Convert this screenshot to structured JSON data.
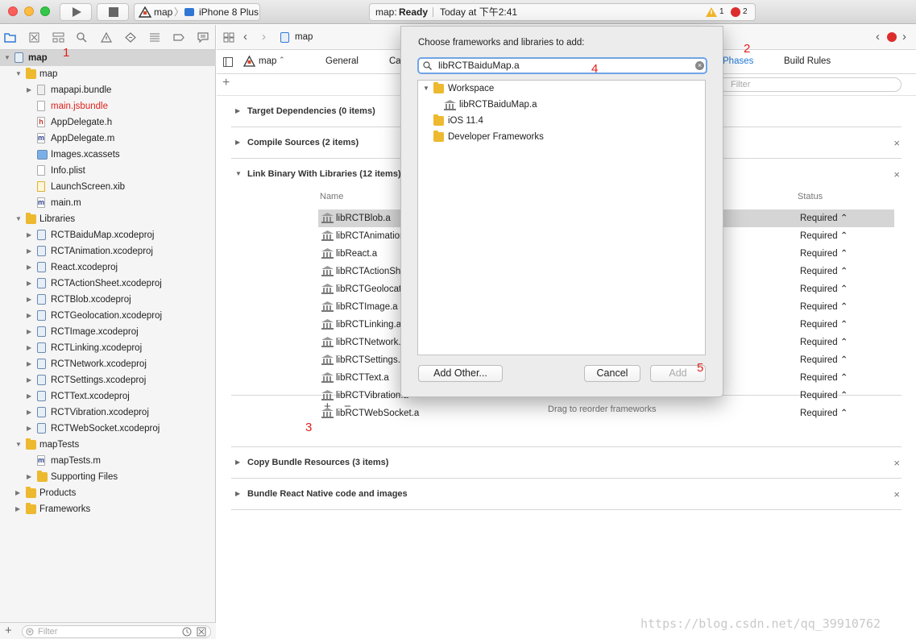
{
  "toolbar": {
    "scheme_target": "map",
    "scheme_device": "iPhone 8 Plus",
    "status_app": "map:",
    "status_state": "Ready",
    "status_time": "Today at 下午2:41",
    "warning_count": "1",
    "error_count": "2"
  },
  "navigator": {
    "items": [
      {
        "label": "map",
        "depth": 0,
        "icon": "project",
        "open": true
      },
      {
        "label": "map",
        "depth": 1,
        "icon": "folder",
        "open": true
      },
      {
        "label": "mapapi.bundle",
        "depth": 2,
        "icon": "bundle",
        "closed": true
      },
      {
        "label": "main.jsbundle",
        "depth": 2,
        "icon": "file",
        "red": true
      },
      {
        "label": "AppDelegate.h",
        "depth": 2,
        "icon": "h"
      },
      {
        "label": "AppDelegate.m",
        "depth": 2,
        "icon": "m"
      },
      {
        "label": "Images.xcassets",
        "depth": 2,
        "icon": "assets"
      },
      {
        "label": "Info.plist",
        "depth": 2,
        "icon": "file"
      },
      {
        "label": "LaunchScreen.xib",
        "depth": 2,
        "icon": "xib"
      },
      {
        "label": "main.m",
        "depth": 2,
        "icon": "m"
      },
      {
        "label": "Libraries",
        "depth": 1,
        "icon": "folder",
        "open": true
      },
      {
        "label": "RCTBaiduMap.xcodeproj",
        "depth": 2,
        "icon": "project",
        "closed": true
      },
      {
        "label": "RCTAnimation.xcodeproj",
        "depth": 2,
        "icon": "project",
        "closed": true
      },
      {
        "label": "React.xcodeproj",
        "depth": 2,
        "icon": "project",
        "closed": true
      },
      {
        "label": "RCTActionSheet.xcodeproj",
        "depth": 2,
        "icon": "project",
        "closed": true
      },
      {
        "label": "RCTBlob.xcodeproj",
        "depth": 2,
        "icon": "project",
        "closed": true
      },
      {
        "label": "RCTGeolocation.xcodeproj",
        "depth": 2,
        "icon": "project",
        "closed": true
      },
      {
        "label": "RCTImage.xcodeproj",
        "depth": 2,
        "icon": "project",
        "closed": true
      },
      {
        "label": "RCTLinking.xcodeproj",
        "depth": 2,
        "icon": "project",
        "closed": true
      },
      {
        "label": "RCTNetwork.xcodeproj",
        "depth": 2,
        "icon": "project",
        "closed": true
      },
      {
        "label": "RCTSettings.xcodeproj",
        "depth": 2,
        "icon": "project",
        "closed": true
      },
      {
        "label": "RCTText.xcodeproj",
        "depth": 2,
        "icon": "project",
        "closed": true
      },
      {
        "label": "RCTVibration.xcodeproj",
        "depth": 2,
        "icon": "project",
        "closed": true
      },
      {
        "label": "RCTWebSocket.xcodeproj",
        "depth": 2,
        "icon": "project",
        "closed": true
      },
      {
        "label": "mapTests",
        "depth": 1,
        "icon": "folder",
        "open": true
      },
      {
        "label": "mapTests.m",
        "depth": 2,
        "icon": "m"
      },
      {
        "label": "Supporting Files",
        "depth": 2,
        "icon": "folder",
        "closed": true
      },
      {
        "label": "Products",
        "depth": 1,
        "icon": "folder",
        "closed": true
      },
      {
        "label": "Frameworks",
        "depth": 1,
        "icon": "folder",
        "closed": true
      }
    ],
    "filter_placeholder": "Filter"
  },
  "editor": {
    "breadcrumb": "map",
    "target_name": "map",
    "tabs": {
      "general": "General",
      "capabilities_partial": "Ca",
      "phases_partial": "Phases",
      "build_rules": "Build Rules"
    },
    "filter_placeholder": "Filter",
    "sections": {
      "target_dependencies": "Target Dependencies (0 items)",
      "compile_sources": "Compile Sources (2 items)",
      "link_binary": "Link Binary With Libraries (12 items)",
      "copy_bundle": "Copy Bundle Resources (3 items)",
      "bundle_react": "Bundle React Native code and images"
    },
    "link_table": {
      "col_name": "Name",
      "col_status": "Status",
      "rows": [
        {
          "name": "libRCTBlob.a",
          "status": "Required"
        },
        {
          "name": "libRCTAnimation.a",
          "status": "Required"
        },
        {
          "name": "libReact.a",
          "status": "Required"
        },
        {
          "name": "libRCTActionSheet.a",
          "status": "Required"
        },
        {
          "name": "libRCTGeolocation.a",
          "status": "Required"
        },
        {
          "name": "libRCTImage.a",
          "status": "Required"
        },
        {
          "name": "libRCTLinking.a",
          "status": "Required"
        },
        {
          "name": "libRCTNetwork.a",
          "status": "Required"
        },
        {
          "name": "libRCTSettings.a",
          "status": "Required"
        },
        {
          "name": "libRCTText.a",
          "status": "Required"
        },
        {
          "name": "libRCTVibration.a",
          "status": "Required"
        },
        {
          "name": "libRCTWebSocket.a",
          "status": "Required"
        }
      ],
      "drag_hint": "Drag to reorder frameworks"
    }
  },
  "dialog": {
    "title": "Choose frameworks and libraries to add:",
    "search_value": "libRCTBaiduMap.a",
    "tree": {
      "workspace": "Workspace",
      "lib": "libRCTBaiduMap.a",
      "ios": "iOS 11.4",
      "devframeworks": "Developer Frameworks"
    },
    "add_other": "Add Other...",
    "cancel": "Cancel",
    "add": "Add"
  },
  "annotations": {
    "n1": "1",
    "n2": "2",
    "n3": "3",
    "n4": "4",
    "n5": "5"
  },
  "watermark": "https://blog.csdn.net/qq_39910762",
  "colors": {
    "accent": "#1e7bd8",
    "annotation_red": "#e0201b",
    "selection": "#d5d5d5",
    "folder": "#ecb92f"
  }
}
